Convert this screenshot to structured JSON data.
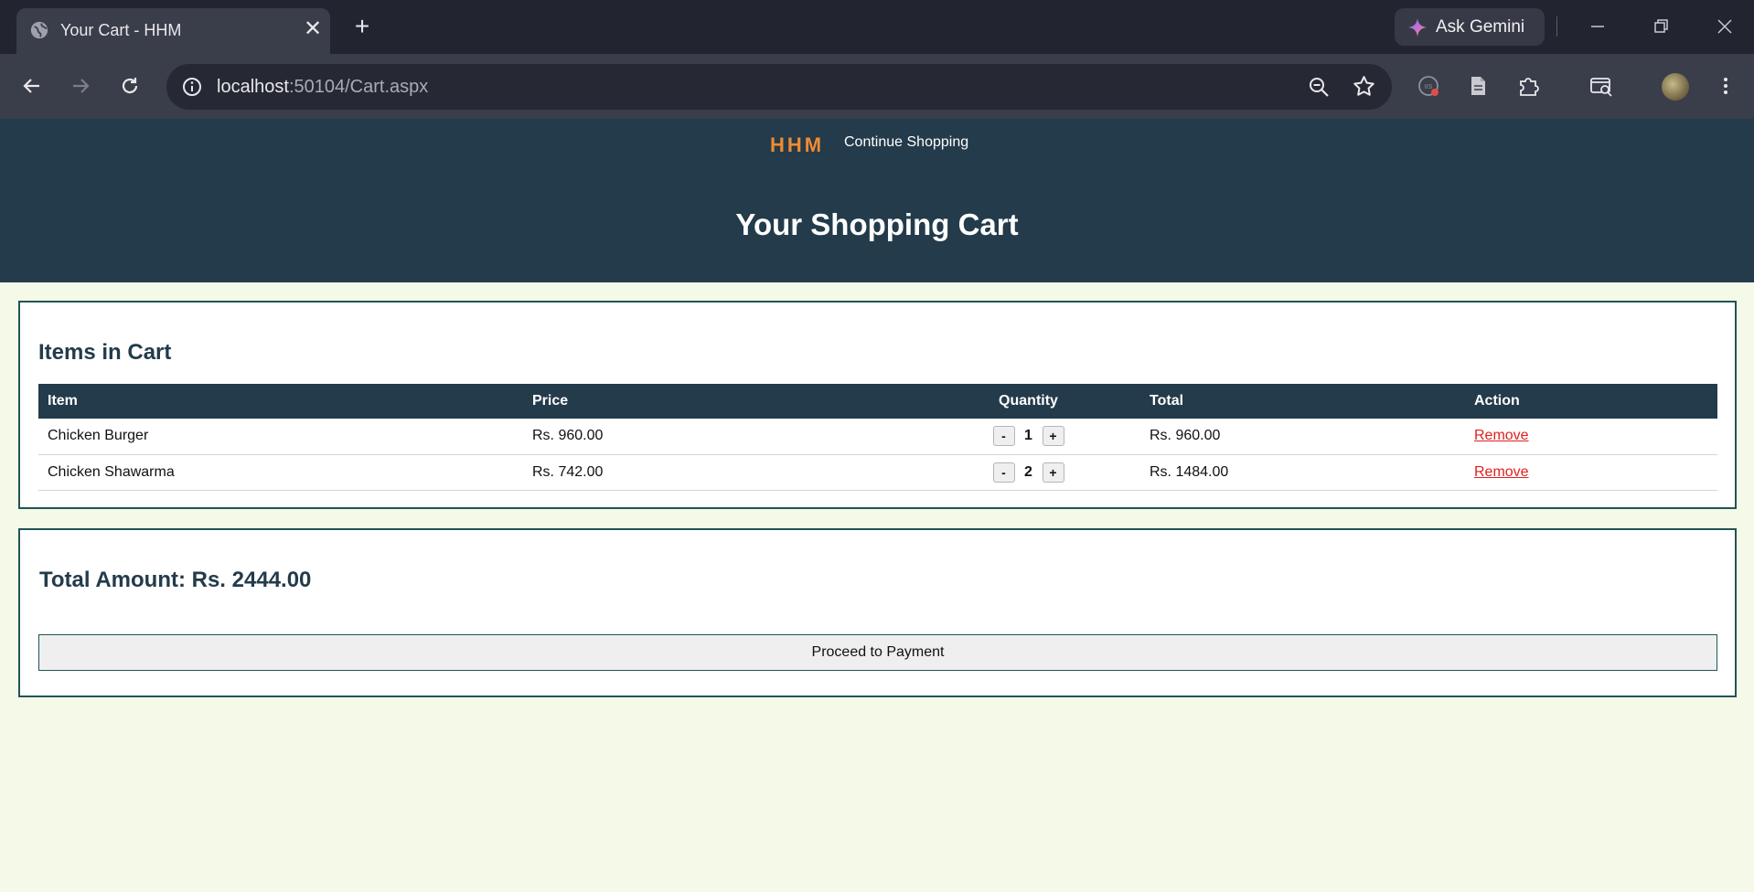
{
  "browser": {
    "tab_title": "Your Cart - HHM",
    "tab_close_glyph": "✕",
    "new_tab_glyph": "+",
    "gemini_label": "Ask Gemini",
    "url_host": "localhost",
    "url_path": ":50104/Cart.aspx",
    "icons": [
      "globe-icon",
      "close-icon",
      "plus-icon",
      "gemini-icon",
      "minimize-icon",
      "restore-icon",
      "window-close-icon",
      "back-icon",
      "forward-icon",
      "reload-icon",
      "info-icon",
      "zoom-icon",
      "bookmark-star-icon",
      "extension-icon",
      "document-icon",
      "puzzle-icon",
      "tab-search-icon",
      "avatar",
      "kebab-menu-icon"
    ]
  },
  "header": {
    "logo": "HHM",
    "continue_link": "Continue Shopping",
    "title": "Your Shopping Cart"
  },
  "cart": {
    "section_title": "Items in Cart",
    "columns": [
      "Item",
      "Price",
      "Quantity",
      "Total",
      "Action"
    ],
    "rows": [
      {
        "item": "Chicken Burger",
        "price": "Rs. 960.00",
        "quantity": "1",
        "total": "Rs. 960.00",
        "action": "Remove"
      },
      {
        "item": "Chicken Shawarma",
        "price": "Rs. 742.00",
        "quantity": "2",
        "total": "Rs. 1484.00",
        "action": "Remove"
      }
    ],
    "minus_label": "-",
    "plus_label": "+"
  },
  "summary": {
    "total_amount": "Total Amount: Rs. 2444.00",
    "pay_button": "Proceed to Payment"
  },
  "colors": {
    "header_bg": "#233b4b",
    "logo": "#f28a30",
    "page_bg": "#f5f9e8",
    "remove_link": "#e02020",
    "card_border": "#1f5555"
  }
}
